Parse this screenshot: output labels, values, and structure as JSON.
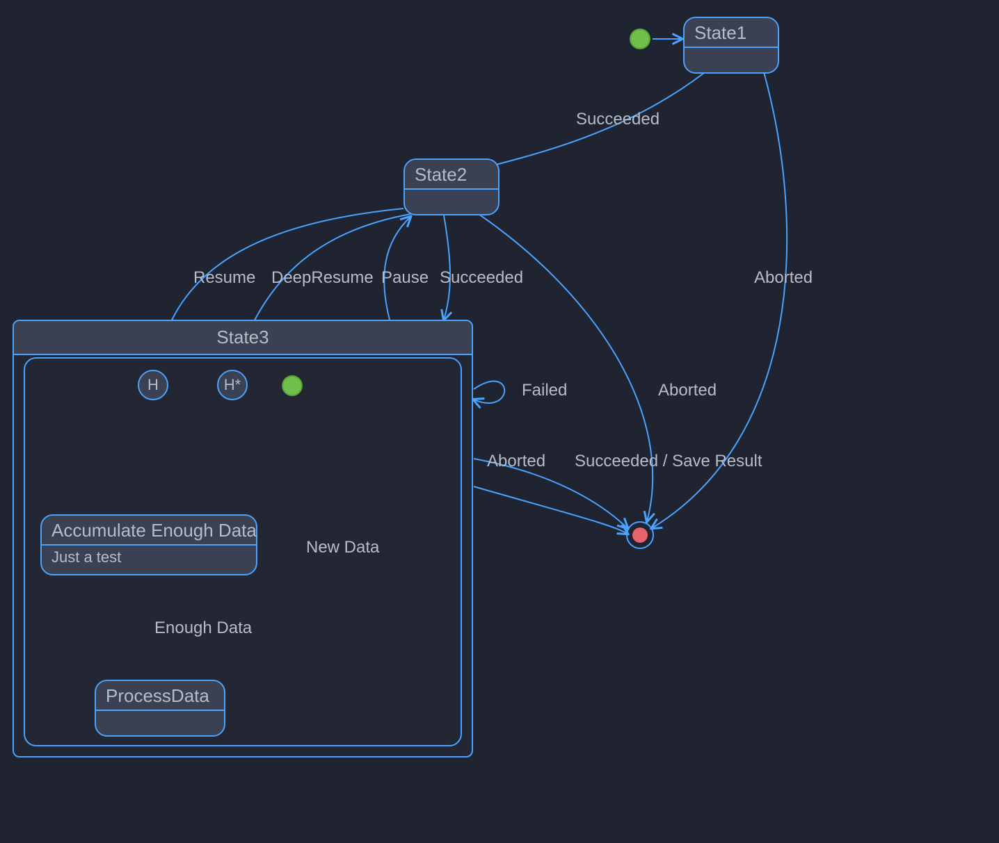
{
  "colors": {
    "bg": "#1f2430",
    "node_fill": "#3a4152",
    "border": "#4aa3ff",
    "text": "#b6bcc8",
    "initial": "#6fbf4b",
    "final_inner": "#e5646e"
  },
  "states": {
    "state1": {
      "label": "State1"
    },
    "state2": {
      "label": "State2"
    },
    "state3": {
      "label": "State3"
    },
    "accumulate": {
      "label": "Accumulate Enough Data",
      "subtext": "Just a test"
    },
    "process": {
      "label": "ProcessData"
    }
  },
  "pseudostates": {
    "initial_top": {
      "kind": "initial"
    },
    "history_shallow": {
      "kind": "history",
      "glyph": "H"
    },
    "history_deep": {
      "kind": "deep-history",
      "glyph": "H*"
    },
    "initial_inner": {
      "kind": "initial"
    },
    "final": {
      "kind": "final"
    }
  },
  "transitions": {
    "init_to_state1": {
      "label": ""
    },
    "state1_to_state2": {
      "label": "Succeeded"
    },
    "state1_to_final": {
      "label": "Aborted"
    },
    "state2_to_final_aborted": {
      "label": "Aborted"
    },
    "state2_to_state3_succeeded": {
      "label": "Succeeded"
    },
    "state3_to_state2_pause": {
      "label": "Pause"
    },
    "state2_to_h_resume": {
      "label": "Resume"
    },
    "state2_to_hstar_deepresume": {
      "label": "DeepResume"
    },
    "state3_self_failed": {
      "label": "Failed"
    },
    "state3_to_final_aborted": {
      "label": "Aborted"
    },
    "state3_to_final_succeeded": {
      "label": "Succeeded / Save Result"
    },
    "initinner_to_accumulate": {
      "label": ""
    },
    "accumulate_self_newdata": {
      "label": "New Data"
    },
    "accumulate_to_process": {
      "label": "Enough Data"
    }
  }
}
